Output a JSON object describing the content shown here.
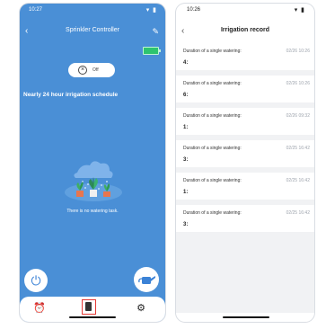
{
  "left_screen": {
    "status_time": "10:27",
    "status_icons": "▾ ▮",
    "title": "Sprinkler Controller",
    "switch_label": "Off",
    "schedule_label": "Nearly 24 hour irrigation schedule",
    "empty_message": "There is no watering task."
  },
  "right_screen": {
    "status_time": "10:26",
    "status_icons": "▾ ▮",
    "title": "Irrigation record",
    "records": [
      {
        "title": "Duration of a single watering:",
        "time": "02/26 10:26",
        "value": "4:"
      },
      {
        "title": "Duration of a single watering:",
        "time": "02/26 10:26",
        "value": "6:"
      },
      {
        "title": "Duration of a single watering:",
        "time": "02/26 09:32",
        "value": "1:"
      },
      {
        "title": "Duration of a single watering:",
        "time": "02/25 16:42",
        "value": "3:"
      },
      {
        "title": "Duration of a single watering:",
        "time": "02/25 16:42",
        "value": "1:"
      },
      {
        "title": "Duration of a single watering:",
        "time": "02/25 16:42",
        "value": "3:"
      }
    ]
  },
  "colors": {
    "primary_blue": "#4a8fd6",
    "battery_green": "#2ec470",
    "highlight_red": "#e53935"
  },
  "icons": {
    "back": "back-icon",
    "edit": "edit-icon",
    "power": "power-icon",
    "water": "watering-can-icon",
    "alarm": "alarm-clock-icon",
    "record": "record-icon",
    "settings": "gear-icon"
  }
}
